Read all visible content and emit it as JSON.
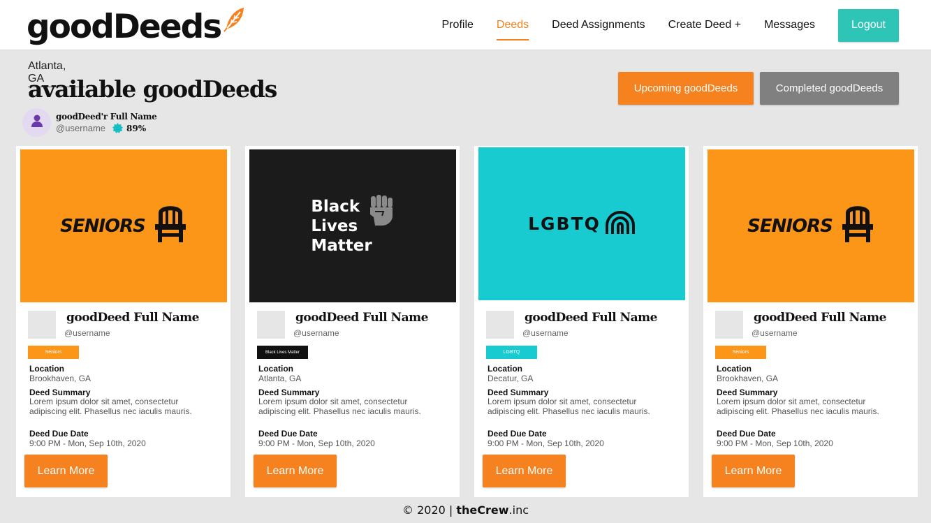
{
  "header": {
    "logo_text": "goodDeeds",
    "nav": [
      {
        "label": "Profile"
      },
      {
        "label": "Deeds",
        "active": true
      },
      {
        "label": "Deed Assignments"
      },
      {
        "label": "Create Deed +"
      },
      {
        "label": "Messages"
      }
    ],
    "logout_label": "Logout"
  },
  "page": {
    "location": "Atlanta, GA",
    "title": "available goodDeeds",
    "user": {
      "name": "goodDeed'r Full Name",
      "username": "@username",
      "score": "89%"
    },
    "upcoming_label": "Upcoming goodDeeds",
    "completed_label": "Completed goodDeeds"
  },
  "cards": [
    {
      "image_text": "SENIORS",
      "image_icon": "chair-icon",
      "image_bg": "#fb9618",
      "name": "goodDeed Full Name",
      "username": "@username",
      "tag": "Seniors",
      "tag_color": "#fb9618",
      "location_label": "Location",
      "location": "Brookhaven, GA",
      "summary_label": "Deed Summary",
      "summary": "Lorem ipsum dolor sit amet, consectetur adipiscing elit. Phasellus nec iaculis mauris.",
      "due_label": "Deed Due Date",
      "due": "9:00 PM - Mon, Sep 10th, 2020",
      "button": "Learn More"
    },
    {
      "image_text": "Black Lives Matter",
      "image_lines": [
        "Black",
        "Lives",
        "Matter"
      ],
      "image_icon": "fist-icon",
      "image_bg": "#1b1b1b",
      "name": "goodDeed Full Name",
      "username": "@username",
      "tag": "Black Lives Matter",
      "tag_color": "#111111",
      "location_label": "Location",
      "location": "Atlanta, GA",
      "summary_label": "Deed Summary",
      "summary": "Lorem ipsum dolor sit amet, consectetur adipiscing elit. Phasellus nec iaculis mauris.",
      "due_label": "Deed Due Date",
      "due": "9:00 PM - Mon, Sep 10th, 2020",
      "button": "Learn More"
    },
    {
      "image_text": "LGBTQ",
      "image_icon": "rainbow-icon",
      "image_bg": "#17cbd1",
      "name": "goodDeed Full Name",
      "username": "@username",
      "tag": "LGBTQ",
      "tag_color": "#17cbd1",
      "location_label": "Location",
      "location": "Decatur, GA",
      "summary_label": "Deed Summary",
      "summary": "Lorem ipsum dolor sit amet, consectetur adipiscing elit. Phasellus nec iaculis mauris.",
      "due_label": "Deed Due Date",
      "due": "9:00 PM - Mon, Sep 10th, 2020",
      "button": "Learn More"
    },
    {
      "image_text": "SENIORS",
      "image_icon": "chair-icon",
      "image_bg": "#fb9618",
      "name": "goodDeed Full Name",
      "username": "@username",
      "tag": "Seniors",
      "tag_color": "#fb9618",
      "location_label": "Location",
      "location": "Brookhaven, GA",
      "summary_label": "Deed Summary",
      "summary": "Lorem ipsum dolor sit amet, consectetur adipiscing elit. Phasellus nec iaculis mauris.",
      "due_label": "Deed Due Date",
      "due": "9:00 PM - Mon, Sep 10th, 2020",
      "button": "Learn More"
    }
  ],
  "footer": {
    "copyright": "© 2020 | ",
    "brand": "theCrew",
    "suffix": ".inc"
  },
  "colors": {
    "accent": "#f5821f",
    "teal": "#2ec4b6",
    "gray_button": "#808080"
  }
}
